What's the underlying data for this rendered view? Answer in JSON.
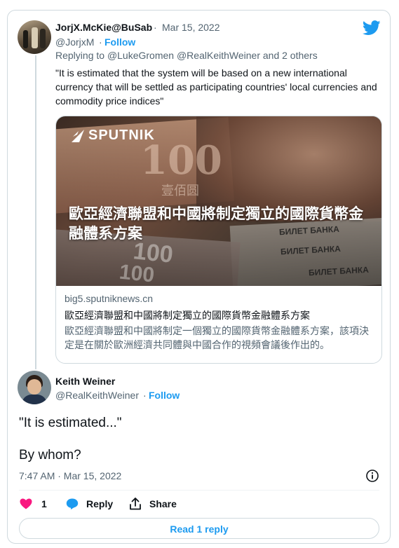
{
  "tweet1": {
    "display_name": "JorjX.McKie@BuSab",
    "separator": "·",
    "date": "Mar 15, 2022",
    "handle": "@JorjxM",
    "follow": "Follow",
    "replying_prefix": "Replying to",
    "replying_users": "@LukeGromen @RealKeithWeiner",
    "replying_and": "and",
    "replying_others": "2 others",
    "text": "\"It is estimated that the system will be based on a new international currency that will be settled as participating countries' local currencies and commodity price indices\""
  },
  "link_card": {
    "brand": "SPUTNIK",
    "headline_overlay": "歐亞經濟聯盟和中國將制定獨立的國際貨幣金融體系方案",
    "domain": "big5.sputniknews.cn",
    "title": "歐亞經濟聯盟和中國將制定獨立的國際貨幣金融體系方案",
    "description": "歐亞經濟聯盟和中國將制定一個獨立的國際貨幣金融體系方案，該項決定是在關於歐洲經濟共同體與中國合作的視頻會議後作出的。",
    "banknote_text_1": "100",
    "banknote_text_2": "壹佰圆",
    "banknote_text_3": "БИЛЕТ БАНКА",
    "banknote_text_4": "БИЛЕТ БАНКА",
    "banknote_text_5": "БИЛЕТ БАНКА",
    "banknote_text_6": "100",
    "banknote_text_7": "100"
  },
  "tweet2": {
    "display_name": "Keith Weiner",
    "handle": "@RealKeithWeiner",
    "separator": "·",
    "follow": "Follow",
    "line1": "\"It is estimated...\"",
    "line2": "By whom?",
    "time": "7:47 AM · Mar 15, 2022",
    "likes": "1",
    "reply_label": "Reply",
    "share_label": "Share"
  },
  "read_replies": "Read 1 reply",
  "colors": {
    "accent": "#1d9bf0",
    "like": "#f91880",
    "muted": "#536471",
    "border": "#cfd9de"
  },
  "icons": [
    "twitter-bird-icon",
    "info-icon",
    "heart-icon",
    "reply-icon",
    "share-icon"
  ]
}
